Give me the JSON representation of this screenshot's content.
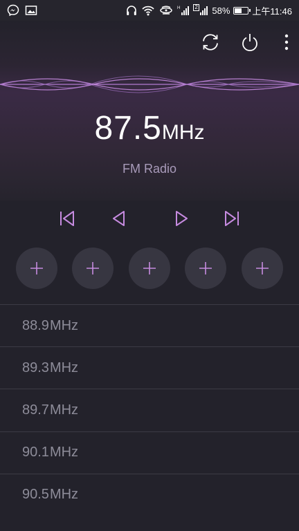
{
  "status_bar": {
    "battery_percent": "58%",
    "battery_level": 0.58,
    "time": "上午11:46",
    "sim_badge": "2",
    "icons": [
      "messenger-icon",
      "gallery-icon",
      "headphones-icon",
      "wifi-icon",
      "hotspot-icon",
      "signal-icon",
      "signal-icon",
      "battery-icon"
    ]
  },
  "toolbar": {
    "icons": [
      "refresh-icon",
      "power-icon",
      "more-vertical-icon"
    ]
  },
  "player": {
    "frequency": "87.5",
    "unit": "MHz",
    "band": "FM Radio"
  },
  "controls": {
    "icons": [
      "skip-previous-icon",
      "seek-back-icon",
      "seek-forward-icon",
      "skip-next-icon"
    ]
  },
  "presets": {
    "icon": "plus-icon",
    "count": 5
  },
  "stations": [
    {
      "freq": "88.9",
      "unit": "MHz"
    },
    {
      "freq": "89.3",
      "unit": "MHz"
    },
    {
      "freq": "89.7",
      "unit": "MHz"
    },
    {
      "freq": "90.1",
      "unit": "MHz"
    },
    {
      "freq": "90.5",
      "unit": "MHz"
    }
  ],
  "colors": {
    "accent": "#c68be0",
    "background": "#23222b",
    "list_text": "#8d8c99",
    "band_text": "#a99bba"
  }
}
